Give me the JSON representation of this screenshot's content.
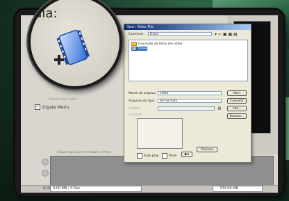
{
  "magnifier": {
    "text": "dia:",
    "icon": "add-media-icon"
  },
  "app": {
    "options": {
      "disabled_option": "Sincronizar sons",
      "menu_checkbox": "Digate Menu",
      "menu_checked": true
    },
    "bottom_note": "Clique aqui para introduzir o menu",
    "status": {
      "left_label": "0:00",
      "left_value": "0:00 MB / 0 Sec",
      "right_value": "700.00 MB"
    }
  },
  "dialog": {
    "title": "Open Video File",
    "lookin_label": "Examinar:",
    "lookin_value": "Dapa",
    "files": [
      "Gravação de fotos em vídeo",
      "Vídeo"
    ],
    "filename_label": "Nome do arquivo:",
    "filename_value": "vídeo",
    "filetype_label": "Arquivos do tipo:",
    "filetype_value": "All Formats",
    "buttons": {
      "open": "Abrir",
      "cancel": "Cancelar",
      "info": "Info...",
      "browse": "Browse...",
      "preview": "Preview"
    },
    "disabled_labels": [
      "Subtitle",
      "Legenda"
    ],
    "autoplay_label": "Auto play",
    "mute_label": "Mute"
  },
  "colors": {
    "titlebar": "#0a246a",
    "folder": "#e9c34d",
    "accent_green": "#2e6b4a"
  }
}
